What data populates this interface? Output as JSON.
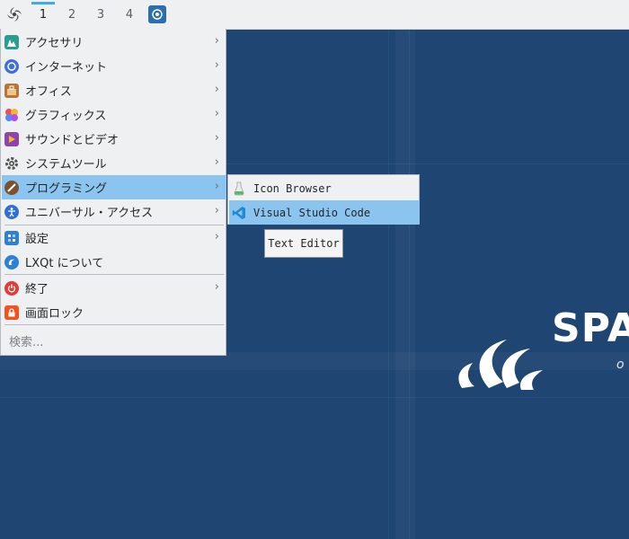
{
  "taskbar": {
    "workspaces": [
      "1",
      "2",
      "3",
      "4"
    ],
    "active_workspace": "1"
  },
  "menu": {
    "items": [
      {
        "label": "アクセサリ",
        "icon": "accessories-icon",
        "submenu": true
      },
      {
        "label": "インターネット",
        "icon": "internet-icon",
        "submenu": true
      },
      {
        "label": "オフィス",
        "icon": "office-icon",
        "submenu": true
      },
      {
        "label": "グラフィックス",
        "icon": "graphics-icon",
        "submenu": true
      },
      {
        "label": "サウンドとビデオ",
        "icon": "multimedia-icon",
        "submenu": true
      },
      {
        "label": "システムツール",
        "icon": "system-tools-icon",
        "submenu": true
      },
      {
        "label": "プログラミング",
        "icon": "programming-icon",
        "submenu": true,
        "highlighted": true
      },
      {
        "label": "ユニバーサル・アクセス",
        "icon": "accessibility-icon",
        "submenu": true
      },
      {
        "label": "設定",
        "icon": "settings-icon",
        "submenu": true
      },
      {
        "label": "LXQt について",
        "icon": "about-lxqt-icon",
        "submenu": false
      },
      {
        "label": "終了",
        "icon": "power-icon",
        "submenu": true
      },
      {
        "label": "画面ロック",
        "icon": "lock-icon",
        "submenu": false
      }
    ],
    "search_placeholder": "検索..."
  },
  "submenu": {
    "items": [
      {
        "label": "Icon Browser",
        "icon": "icon-browser-icon"
      },
      {
        "label": "Visual Studio Code",
        "icon": "vscode-icon",
        "highlighted": true
      }
    ]
  },
  "tooltip": {
    "text": "Text Editor"
  },
  "desktop": {
    "logo_text": "SPA",
    "logo_sub": "o"
  },
  "colors": {
    "highlight": "#8bc4ef",
    "menu_bg": "#eff0f1",
    "desktop_bg": "#1f4573",
    "accent": "#3daee9"
  }
}
